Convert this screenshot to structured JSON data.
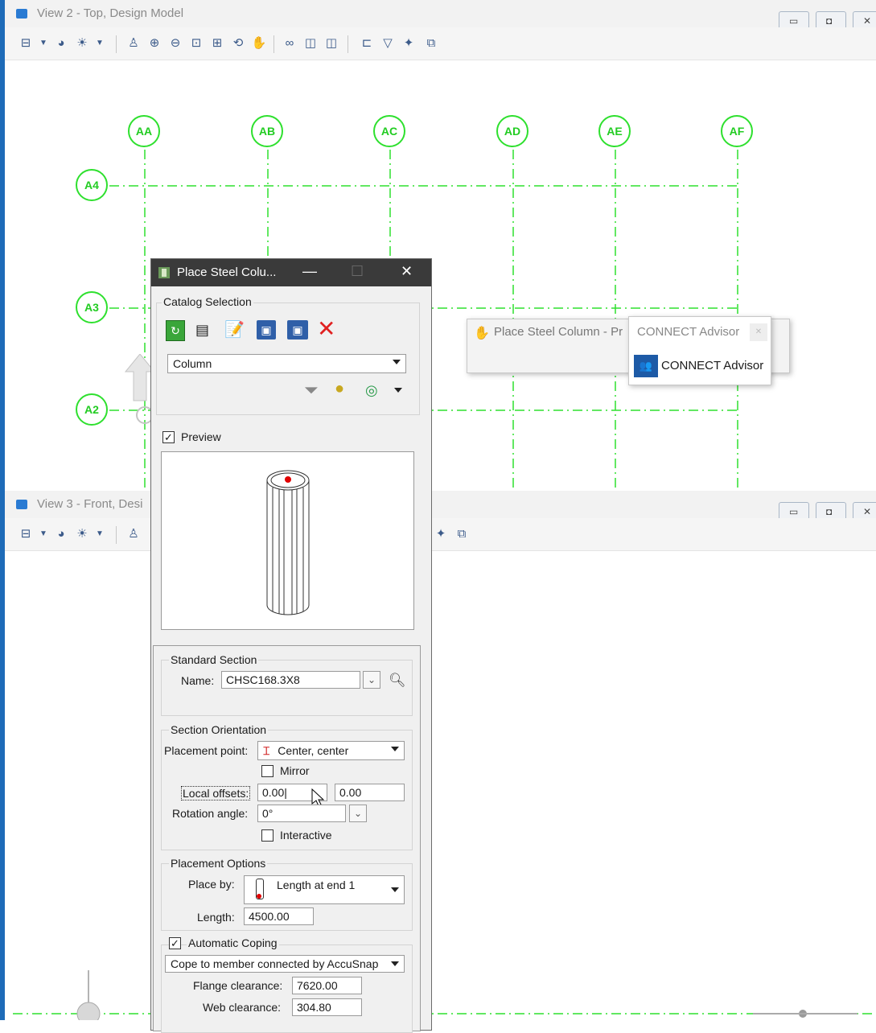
{
  "view2": {
    "title": "View 2 - Top, Design Model"
  },
  "view3": {
    "title": "View 3 - Front, Desi"
  },
  "grid": {
    "columns": [
      "AA",
      "AB",
      "AC",
      "AD",
      "AE",
      "AF"
    ],
    "rows": [
      "A4",
      "A3",
      "A2"
    ],
    "color": "#2ee02e"
  },
  "dialog": {
    "title": "Place Steel Colu...",
    "catalog_selection": {
      "label": "Catalog Selection",
      "type_value": "Column"
    },
    "preview": {
      "label": "Preview",
      "checked": true
    },
    "standard_section": {
      "label": "Standard Section",
      "name_label": "Name:",
      "name_value": "CHSC168.3X8"
    },
    "section_orientation": {
      "label": "Section Orientation",
      "placement_point_label": "Placement point:",
      "placement_point_value": "Center, center",
      "mirror_label": "Mirror",
      "local_offsets_label": "Local offsets:",
      "offset_x": "0.00",
      "offset_y": "0.00",
      "rotation_label": "Rotation angle:",
      "rotation_value": "0°",
      "interactive_label": "Interactive"
    },
    "placement_options": {
      "label": "Placement Options",
      "place_by_label": "Place by:",
      "place_by_value": "Length at end 1",
      "length_label": "Length:",
      "length_value": "4500.00"
    },
    "automatic_coping": {
      "label": "Automatic Coping",
      "checked": true,
      "cope_value": "Cope to member connected by AccuSnap",
      "flange_label": "Flange clearance:",
      "flange_value": "7620.00",
      "web_label": "Web clearance:",
      "web_value": "304.80"
    }
  },
  "popup": {
    "task_text": "Place Steel Column - Pr",
    "advisor_header": "CONNECT Advisor",
    "advisor_item": "CONNECT Advisor"
  }
}
